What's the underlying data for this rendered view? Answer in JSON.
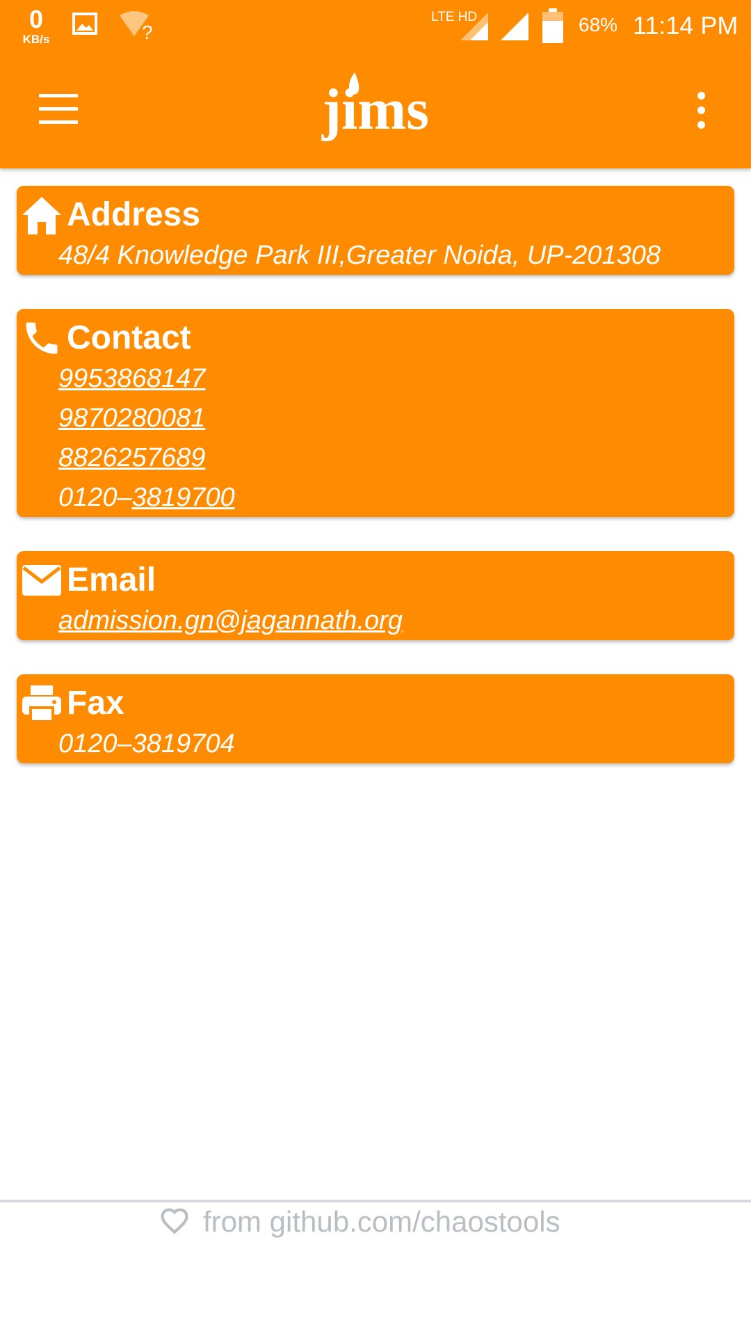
{
  "status_bar": {
    "speed_value": "0",
    "speed_unit": "KB/s",
    "network_label": "LTE HD",
    "battery_pct": "68%",
    "time": "11:14 PM"
  },
  "app_bar": {
    "logo_text": "jims",
    "menu_icon": "hamburger-icon",
    "overflow_icon": "more-vert-icon"
  },
  "cards": {
    "address": {
      "icon": "home-icon",
      "title": "Address",
      "text": "48/4 Knowledge Park III,Greater Noida, UP-201308"
    },
    "contact": {
      "icon": "phone-icon",
      "title": "Contact",
      "phones": [
        "9953868147",
        "9870280081",
        "8826257689"
      ],
      "landline_prefix": "0120–",
      "landline_number": "3819700"
    },
    "email": {
      "icon": "mail-icon",
      "title": "Email",
      "address": "admission.gn@jagannath.org"
    },
    "fax": {
      "icon": "printer-icon",
      "title": "Fax",
      "number": "0120–3819704"
    }
  },
  "footer": {
    "icon": "heart-outline-icon",
    "text": "from github.com/chaostools"
  },
  "colors": {
    "accent": "#FF8C00",
    "footer_text": "#B9BEC3"
  }
}
